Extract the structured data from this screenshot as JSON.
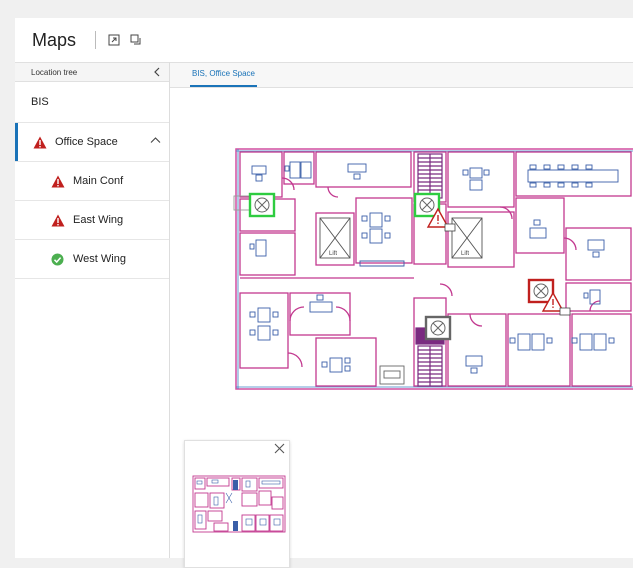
{
  "header": {
    "title": "Maps",
    "icons": [
      "expand-icon",
      "copy-icon"
    ]
  },
  "sidebar": {
    "title": "Location tree",
    "root": "BIS",
    "items": [
      {
        "label": "Office Space",
        "status": "alarm",
        "level": 1,
        "expanded": true,
        "selected": true
      },
      {
        "label": "Main Conf",
        "status": "alarm",
        "level": 2
      },
      {
        "label": "East Wing",
        "status": "alarm",
        "level": 2
      },
      {
        "label": "West Wing",
        "status": "ok",
        "level": 2
      }
    ]
  },
  "main": {
    "tab": "BIS, Office Space"
  },
  "floorplan": {
    "lift_label": "Lift"
  },
  "colors": {
    "accent": "#1a73b8",
    "wall": "#c2388f",
    "alarm": "#c0201e",
    "ok": "#4caf50",
    "camera_ok": "#2ecc40",
    "camera_alarm": "#c0201e",
    "camera_idle": "#666666"
  }
}
